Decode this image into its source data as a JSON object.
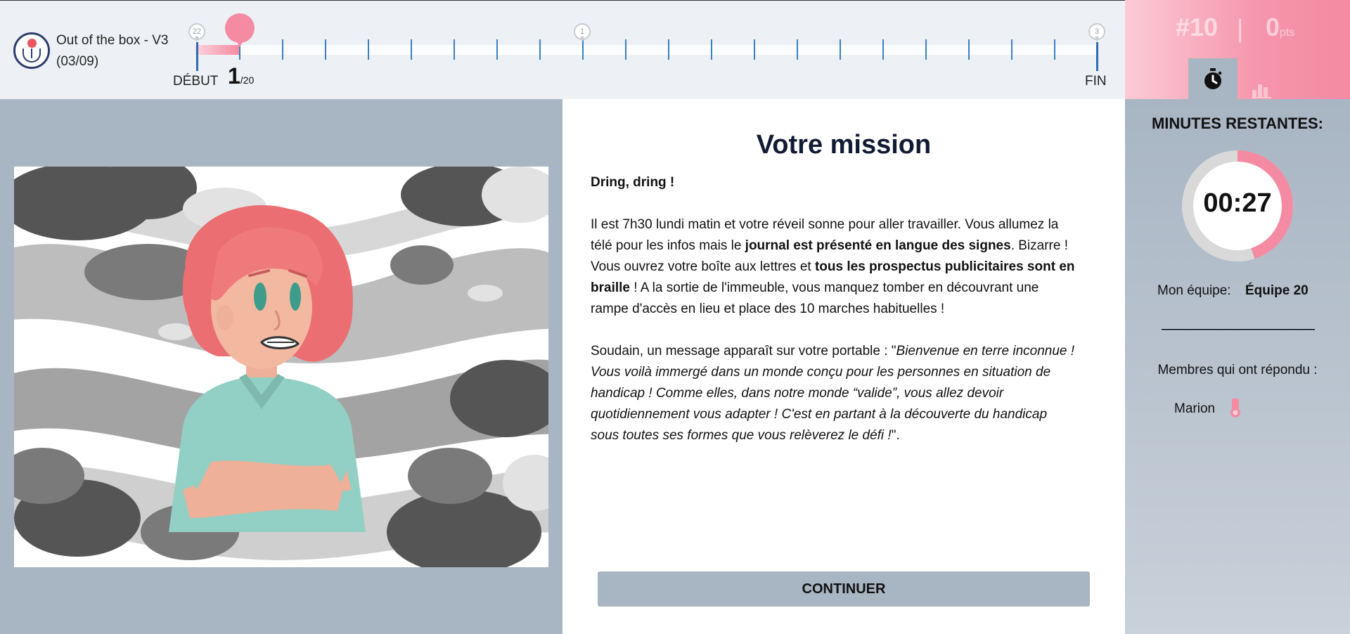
{
  "header": {
    "game_title": "Out of the box - V3",
    "game_date": "(03/09)",
    "progress": {
      "start_label": "DÉBUT",
      "end_label": "FIN",
      "current_step": "1",
      "total_steps": "/20",
      "milestones": [
        "22",
        "1",
        "3"
      ]
    }
  },
  "score": {
    "rank": "#10",
    "separator": "|",
    "points": "0",
    "points_unit": "pts",
    "tabs": [
      "stopwatch-icon",
      "bar-chart-icon"
    ]
  },
  "sidebar": {
    "minutes_title": "MINUTES RESTANTES:",
    "timer": "00:27",
    "timer_fraction_remaining": 0.45,
    "team_label": "Mon équipe:",
    "team_name": "Équipe 20",
    "members_label": "Membres qui ont répondu :",
    "members": [
      {
        "name": "Marion",
        "icon": "medal-icon"
      }
    ]
  },
  "mission": {
    "title": "Votre mission",
    "intro": "Dring, dring !",
    "p1_a": "Il est 7h30 lundi matin et votre réveil sonne pour aller travailler. Vous allumez la télé pour les infos mais le ",
    "p1_b": "journal est présenté en langue des signes",
    "p1_c": ". Bizarre ! Vous ouvrez votre boîte aux lettres et ",
    "p1_d": "tous les prospectus publicitaires sont en braille",
    "p1_e": " ! A la sortie de l'immeuble, vous manquez tomber en découvrant une rampe d'accès en lieu et place des 10 marches habituelles !",
    "p2_a": "Soudain, un message apparaît sur votre portable : \"",
    "p2_b": "Bienvenue en terre inconnue ! Vous voilà immergé dans un monde conçu pour les personnes en situation de handicap ! Comme elles, dans notre monde “valide”, vous allez devoir quotidiennement vous adapter ! C'est en partant à la découverte du handicap sous toutes ses formes que vous relèverez le défi !",
    "p2_c": "\".",
    "continue_label": "CONTINUER"
  },
  "colors": {
    "accent_pink": "#f48ba2",
    "panel_gray": "#a8b5c3",
    "track_blue": "#2a6db3",
    "title_navy": "#111b33"
  }
}
